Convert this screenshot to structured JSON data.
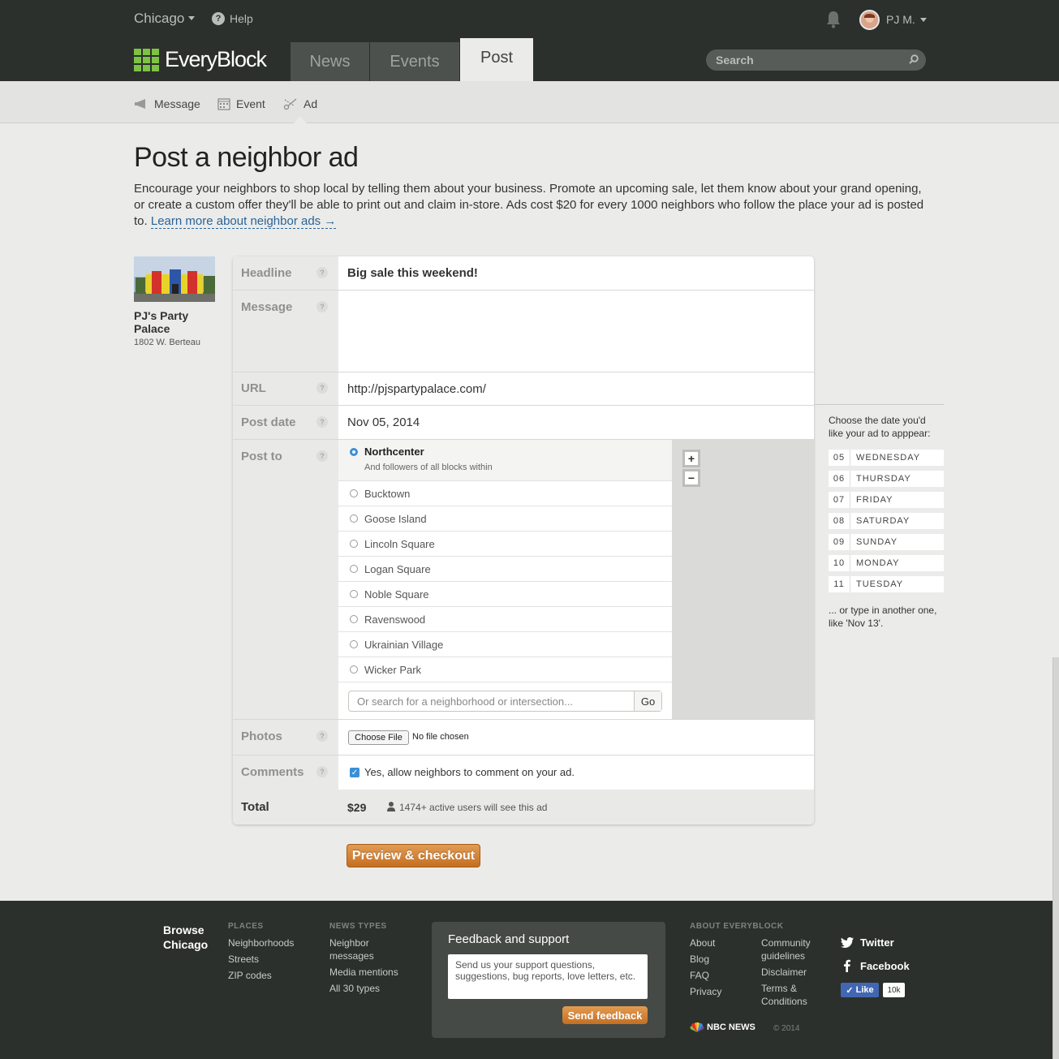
{
  "topbar": {
    "city": "Chicago",
    "help": "Help",
    "user": "PJ M.",
    "logo": "EveryBlock",
    "tabs": [
      "News",
      "Events",
      "Post"
    ],
    "search_placeholder": "Search"
  },
  "subnav": {
    "message": "Message",
    "event": "Event",
    "ad": "Ad"
  },
  "page": {
    "title": "Post a neighbor ad",
    "intro": "Encourage your neighbors to shop local by telling them about your business. Promote an upcoming sale, let them know about your grand opening, or create a custom offer they'll be able to print out and claim in-store. Ads cost $20 for every 1000 neighbors who follow the place your ad is posted to. ",
    "learn_more": "Learn more about neighbor ads →"
  },
  "business": {
    "name": "PJ's Party Palace",
    "address": "1802 W. Berteau"
  },
  "form": {
    "headline_label": "Headline",
    "headline_value": "Big sale this weekend!",
    "message_label": "Message",
    "message_value": "",
    "url_label": "URL",
    "url_value": "http://pjspartypalace.com/",
    "postdate_label": "Post date",
    "postdate_value": "Nov 05, 2014",
    "postto_label": "Post to",
    "selected_hood": "Northcenter",
    "selected_hood_note": "And followers of all blocks within",
    "hoods": [
      "Bucktown",
      "Goose Island",
      "Lincoln Square",
      "Logan Square",
      "Noble Square",
      "Ravenswood",
      "Ukrainian Village",
      "Wicker Park"
    ],
    "hood_search_placeholder": "Or search for a neighborhood or intersection...",
    "go": "Go",
    "zoom_in": "+",
    "zoom_out": "−",
    "photos_label": "Photos",
    "choose_file": "Choose File",
    "no_file": "No file chosen",
    "comments_label": "Comments",
    "comments_text": "Yes, allow neighbors to comment on your ad.",
    "total_label": "Total",
    "total_value": "$29",
    "audience": "1474+ active users will see this ad",
    "qmark": "?"
  },
  "datepicker": {
    "prompt": "Choose the date you'd like your ad to apppear:",
    "days": [
      {
        "n": "05",
        "w": "WEDNESDAY"
      },
      {
        "n": "06",
        "w": "THURSDAY"
      },
      {
        "n": "07",
        "w": "FRIDAY"
      },
      {
        "n": "08",
        "w": "SATURDAY"
      },
      {
        "n": "09",
        "w": "SUNDAY"
      },
      {
        "n": "10",
        "w": "MONDAY"
      },
      {
        "n": "11",
        "w": "TUESDAY"
      }
    ],
    "other": "... or type in another one, like 'Nov 13'."
  },
  "checkout": "Preview & checkout",
  "footer": {
    "browse": "Browse Chicago",
    "places_head": "PLACES",
    "places": [
      "Neighborhoods",
      "Streets",
      "ZIP codes"
    ],
    "newstypes_head": "NEWS TYPES",
    "newstypes": [
      "Neighbor messages",
      "Media mentions",
      "All 30 types"
    ],
    "feedback_title": "Feedback and support",
    "feedback_placeholder": "Send us your support questions, suggestions, bug reports, love letters, etc.",
    "feedback_send": "Send feedback",
    "about_head": "ABOUT EVERYBLOCK",
    "about_col1": [
      "About",
      "Blog",
      "FAQ",
      "Privacy"
    ],
    "about_col2": [
      "Community guidelines",
      "Disclaimer",
      "Terms & Conditions"
    ],
    "twitter": "Twitter",
    "facebook": "Facebook",
    "like": "Like",
    "like_count": "10k",
    "nbc": "NBC NEWS",
    "copyright": "© 2014"
  },
  "colors": {
    "topbar": "#2b302c",
    "logo_green": "#7dc243",
    "accent_orange": "#d07f32",
    "radio_blue": "#3b8fd8"
  }
}
